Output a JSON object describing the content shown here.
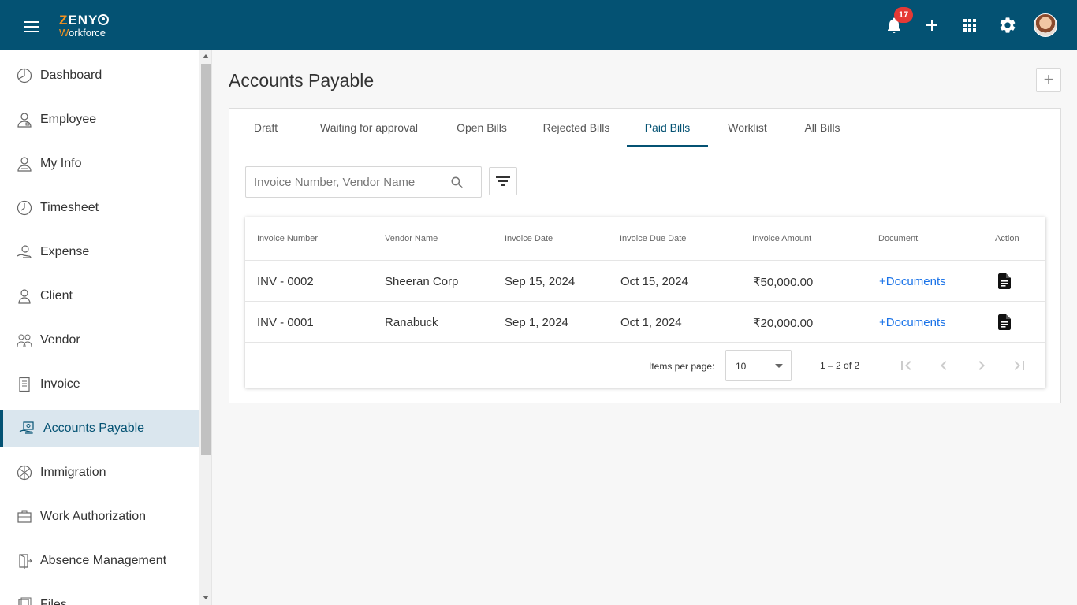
{
  "header": {
    "logo_top_z": "Z",
    "logo_top_rest": "ENY",
    "logo_bottom_w": "W",
    "logo_bottom_rest": "orkforce",
    "notification_count": "17",
    "accent_color": "#045273",
    "logo_accent_color": "#f7931e"
  },
  "sidebar": {
    "items": [
      {
        "label": "Dashboard",
        "icon": "dashboard-icon"
      },
      {
        "label": "Employee",
        "icon": "employee-icon"
      },
      {
        "label": "My Info",
        "icon": "my-info-icon"
      },
      {
        "label": "Timesheet",
        "icon": "clock-icon"
      },
      {
        "label": "Expense",
        "icon": "expense-icon"
      },
      {
        "label": "Client",
        "icon": "client-icon"
      },
      {
        "label": "Vendor",
        "icon": "vendor-icon"
      },
      {
        "label": "Invoice",
        "icon": "invoice-icon"
      },
      {
        "label": "Accounts Payable",
        "icon": "accounts-payable-icon",
        "active": true
      },
      {
        "label": "Immigration",
        "icon": "globe-icon"
      },
      {
        "label": "Work Authorization",
        "icon": "briefcase-icon"
      },
      {
        "label": "Absence Management",
        "icon": "door-icon"
      },
      {
        "label": "Files",
        "icon": "files-icon"
      }
    ]
  },
  "main": {
    "title": "Accounts Payable",
    "tabs": [
      {
        "label": "Draft"
      },
      {
        "label": "Waiting for approval"
      },
      {
        "label": "Open Bills"
      },
      {
        "label": "Rejected Bills"
      },
      {
        "label": "Paid Bills",
        "active": true
      },
      {
        "label": "Worklist"
      },
      {
        "label": "All Bills"
      }
    ],
    "search": {
      "placeholder": "Invoice Number, Vendor Name",
      "value": ""
    },
    "table": {
      "columns": [
        "Invoice Number",
        "Vendor Name",
        "Invoice Date",
        "Invoice Due Date",
        "Invoice Amount",
        "Document",
        "Action"
      ],
      "rows": [
        {
          "invoice_number": "INV - 0002",
          "vendor": "Sheeran Corp",
          "invoice_date": "Sep 15, 2024",
          "due_date": "Oct 15, 2024",
          "amount": "₹50,000.00",
          "document": "+Documents"
        },
        {
          "invoice_number": "INV - 0001",
          "vendor": "Ranabuck",
          "invoice_date": "Sep 1, 2024",
          "due_date": "Oct 1, 2024",
          "amount": "₹20,000.00",
          "document": "+Documents"
        }
      ]
    },
    "paginator": {
      "items_per_page_label": "Items per page:",
      "page_size": "10",
      "range": "1 – 2 of 2"
    }
  }
}
